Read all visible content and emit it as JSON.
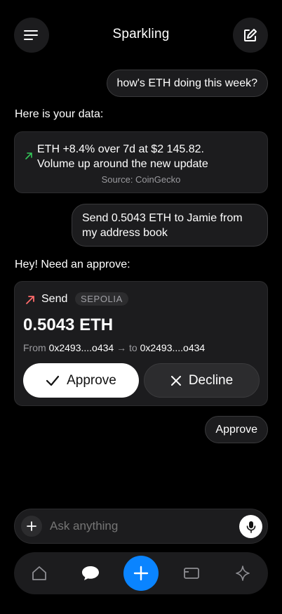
{
  "header": {
    "title": "Sparkling",
    "menu_icon": "menu-icon",
    "edit_icon": "compose-icon"
  },
  "chat": {
    "user_message_1": "how's ETH doing this week?",
    "bot_intro_1": "Here is your data:",
    "market_card": {
      "line_1": "ETH +8.4% over 7d at $2 145.82.",
      "line_2": "Volume up around the new update",
      "source": "Source: CoinGecko",
      "trend_color": "#34c759"
    },
    "user_message_2_line_1": "Send 0.5043 ETH to Jamie from",
    "user_message_2_line_2": "my address book",
    "bot_intro_2": "Hey! Need an approve:",
    "tx_card": {
      "action": "Send",
      "network": "SEPOLIA",
      "amount": "0.5043 ETH",
      "from_label": "From",
      "from_address": "0x2493....o434",
      "arrow": "→",
      "to_label": "to",
      "to_address": "0x2493....o434",
      "send_color": "#ff6b6b",
      "approve_label": "Approve",
      "decline_label": "Decline"
    },
    "user_message_3": "Approve"
  },
  "composer": {
    "placeholder": "Ask anything"
  },
  "bottom_nav": {
    "active_tab": "chat",
    "accent": "#0a84ff"
  }
}
